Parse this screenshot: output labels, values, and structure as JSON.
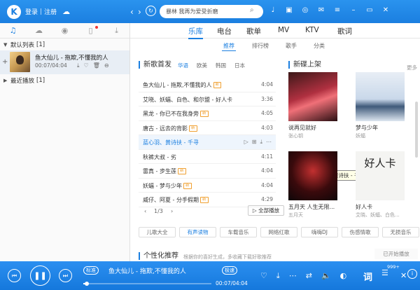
{
  "titlebar": {
    "logo": "K",
    "login": "登录",
    "separator": "|",
    "register": "注册",
    "search_placeholder": "暴林 我再为爱受折磨"
  },
  "sidebar": {
    "section1": "默认列表",
    "section1_count": "[1]",
    "song_name": "鱼大仙儿 - 拖欺,不懂我的人",
    "song_time": "00:07/04:04",
    "section2": "最近播放",
    "section2_count": "[1]"
  },
  "main_tabs": [
    "乐库",
    "电台",
    "歌单",
    "MV",
    "KTV",
    "歌词"
  ],
  "sub_tabs": [
    "推荐",
    "排行榜",
    "歌手",
    "分类"
  ],
  "new_songs": {
    "title": "新歌首发",
    "filters": [
      "华语",
      "欧美",
      "韩国",
      "日本"
    ],
    "songs": [
      {
        "title": "鱼大仙儿 - 拖欺,不懂我的人",
        "duration": "4:04"
      },
      {
        "title": "艾晓、妖蝠、白色、和尔盟 - 好人卡",
        "duration": "3:36"
      },
      {
        "title": "黑龙 - 你已不在我身旁",
        "duration": "4:05"
      },
      {
        "title": "唐古 - 远去的背影",
        "duration": "4:03"
      },
      {
        "title": "蓝心羽、黄诗扶 - 千寻",
        "duration": ""
      },
      {
        "title": "秋裤大叔 - 劣",
        "duration": "4:11"
      },
      {
        "title": "雷真 - 步生莲",
        "duration": "4:04"
      },
      {
        "title": "妖蝠 - 梦与少年",
        "duration": "4:04"
      },
      {
        "title": "威仔、阿夏 - 分手假期",
        "duration": "4:29"
      }
    ],
    "tooltip": "蓝心羽、黄诗扶 - 千寻",
    "page": "1/3",
    "play_all": "全部播放"
  },
  "tags": [
    "儿歌大全",
    "有声读物",
    "车载音乐",
    "网络红歌",
    "嗨嗨DJ",
    "伤感情歌",
    "无损音乐"
  ],
  "personal": {
    "title": "个性化推荐",
    "subtitle": "根据你的喜好生成，多收藏下载好歌推荐"
  },
  "new_albums": {
    "title": "新碟上架",
    "more": "更多",
    "albums": [
      {
        "name": "说再见就好",
        "artist": "张心钥"
      },
      {
        "name": "梦与少年",
        "artist": "妖蝠"
      },
      {
        "name": "五月天 人生无限...",
        "artist": "五月天"
      },
      {
        "name": "好人卡",
        "artist": "艾晓、妖蝠、白色..."
      }
    ],
    "card_text": "好人卡"
  },
  "opened_hint": "已开始播放",
  "player": {
    "mode": "标准",
    "title": "鱼大仙儿 - 拖欺,不懂我的人",
    "quality": "极速",
    "time": "00:07/04:04",
    "progress": 0.03,
    "lyric": "词",
    "count": "999+"
  },
  "colors": {
    "accent": "#1b7fe0",
    "tag_badge": "#f0a030"
  }
}
